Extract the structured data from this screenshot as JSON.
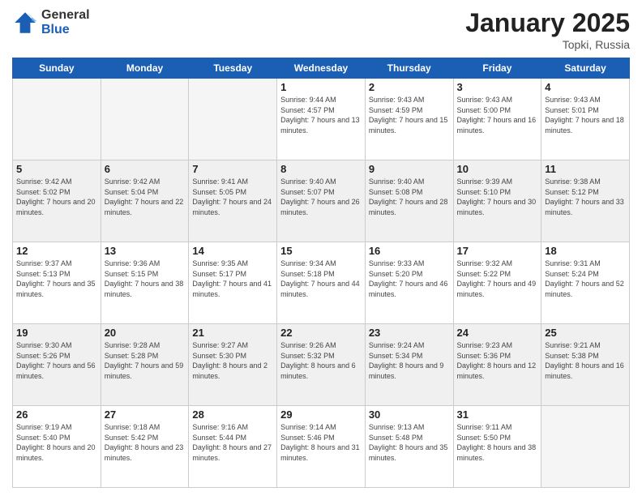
{
  "logo": {
    "general": "General",
    "blue": "Blue"
  },
  "title": {
    "month_year": "January 2025",
    "location": "Topki, Russia"
  },
  "headers": [
    "Sunday",
    "Monday",
    "Tuesday",
    "Wednesday",
    "Thursday",
    "Friday",
    "Saturday"
  ],
  "weeks": [
    [
      {
        "day": "",
        "sunrise": "",
        "sunset": "",
        "daylight": ""
      },
      {
        "day": "",
        "sunrise": "",
        "sunset": "",
        "daylight": ""
      },
      {
        "day": "",
        "sunrise": "",
        "sunset": "",
        "daylight": ""
      },
      {
        "day": "1",
        "sunrise": "Sunrise: 9:44 AM",
        "sunset": "Sunset: 4:57 PM",
        "daylight": "Daylight: 7 hours and 13 minutes."
      },
      {
        "day": "2",
        "sunrise": "Sunrise: 9:43 AM",
        "sunset": "Sunset: 4:59 PM",
        "daylight": "Daylight: 7 hours and 15 minutes."
      },
      {
        "day": "3",
        "sunrise": "Sunrise: 9:43 AM",
        "sunset": "Sunset: 5:00 PM",
        "daylight": "Daylight: 7 hours and 16 minutes."
      },
      {
        "day": "4",
        "sunrise": "Sunrise: 9:43 AM",
        "sunset": "Sunset: 5:01 PM",
        "daylight": "Daylight: 7 hours and 18 minutes."
      }
    ],
    [
      {
        "day": "5",
        "sunrise": "Sunrise: 9:42 AM",
        "sunset": "Sunset: 5:02 PM",
        "daylight": "Daylight: 7 hours and 20 minutes."
      },
      {
        "day": "6",
        "sunrise": "Sunrise: 9:42 AM",
        "sunset": "Sunset: 5:04 PM",
        "daylight": "Daylight: 7 hours and 22 minutes."
      },
      {
        "day": "7",
        "sunrise": "Sunrise: 9:41 AM",
        "sunset": "Sunset: 5:05 PM",
        "daylight": "Daylight: 7 hours and 24 minutes."
      },
      {
        "day": "8",
        "sunrise": "Sunrise: 9:40 AM",
        "sunset": "Sunset: 5:07 PM",
        "daylight": "Daylight: 7 hours and 26 minutes."
      },
      {
        "day": "9",
        "sunrise": "Sunrise: 9:40 AM",
        "sunset": "Sunset: 5:08 PM",
        "daylight": "Daylight: 7 hours and 28 minutes."
      },
      {
        "day": "10",
        "sunrise": "Sunrise: 9:39 AM",
        "sunset": "Sunset: 5:10 PM",
        "daylight": "Daylight: 7 hours and 30 minutes."
      },
      {
        "day": "11",
        "sunrise": "Sunrise: 9:38 AM",
        "sunset": "Sunset: 5:12 PM",
        "daylight": "Daylight: 7 hours and 33 minutes."
      }
    ],
    [
      {
        "day": "12",
        "sunrise": "Sunrise: 9:37 AM",
        "sunset": "Sunset: 5:13 PM",
        "daylight": "Daylight: 7 hours and 35 minutes."
      },
      {
        "day": "13",
        "sunrise": "Sunrise: 9:36 AM",
        "sunset": "Sunset: 5:15 PM",
        "daylight": "Daylight: 7 hours and 38 minutes."
      },
      {
        "day": "14",
        "sunrise": "Sunrise: 9:35 AM",
        "sunset": "Sunset: 5:17 PM",
        "daylight": "Daylight: 7 hours and 41 minutes."
      },
      {
        "day": "15",
        "sunrise": "Sunrise: 9:34 AM",
        "sunset": "Sunset: 5:18 PM",
        "daylight": "Daylight: 7 hours and 44 minutes."
      },
      {
        "day": "16",
        "sunrise": "Sunrise: 9:33 AM",
        "sunset": "Sunset: 5:20 PM",
        "daylight": "Daylight: 7 hours and 46 minutes."
      },
      {
        "day": "17",
        "sunrise": "Sunrise: 9:32 AM",
        "sunset": "Sunset: 5:22 PM",
        "daylight": "Daylight: 7 hours and 49 minutes."
      },
      {
        "day": "18",
        "sunrise": "Sunrise: 9:31 AM",
        "sunset": "Sunset: 5:24 PM",
        "daylight": "Daylight: 7 hours and 52 minutes."
      }
    ],
    [
      {
        "day": "19",
        "sunrise": "Sunrise: 9:30 AM",
        "sunset": "Sunset: 5:26 PM",
        "daylight": "Daylight: 7 hours and 56 minutes."
      },
      {
        "day": "20",
        "sunrise": "Sunrise: 9:28 AM",
        "sunset": "Sunset: 5:28 PM",
        "daylight": "Daylight: 7 hours and 59 minutes."
      },
      {
        "day": "21",
        "sunrise": "Sunrise: 9:27 AM",
        "sunset": "Sunset: 5:30 PM",
        "daylight": "Daylight: 8 hours and 2 minutes."
      },
      {
        "day": "22",
        "sunrise": "Sunrise: 9:26 AM",
        "sunset": "Sunset: 5:32 PM",
        "daylight": "Daylight: 8 hours and 6 minutes."
      },
      {
        "day": "23",
        "sunrise": "Sunrise: 9:24 AM",
        "sunset": "Sunset: 5:34 PM",
        "daylight": "Daylight: 8 hours and 9 minutes."
      },
      {
        "day": "24",
        "sunrise": "Sunrise: 9:23 AM",
        "sunset": "Sunset: 5:36 PM",
        "daylight": "Daylight: 8 hours and 12 minutes."
      },
      {
        "day": "25",
        "sunrise": "Sunrise: 9:21 AM",
        "sunset": "Sunset: 5:38 PM",
        "daylight": "Daylight: 8 hours and 16 minutes."
      }
    ],
    [
      {
        "day": "26",
        "sunrise": "Sunrise: 9:19 AM",
        "sunset": "Sunset: 5:40 PM",
        "daylight": "Daylight: 8 hours and 20 minutes."
      },
      {
        "day": "27",
        "sunrise": "Sunrise: 9:18 AM",
        "sunset": "Sunset: 5:42 PM",
        "daylight": "Daylight: 8 hours and 23 minutes."
      },
      {
        "day": "28",
        "sunrise": "Sunrise: 9:16 AM",
        "sunset": "Sunset: 5:44 PM",
        "daylight": "Daylight: 8 hours and 27 minutes."
      },
      {
        "day": "29",
        "sunrise": "Sunrise: 9:14 AM",
        "sunset": "Sunset: 5:46 PM",
        "daylight": "Daylight: 8 hours and 31 minutes."
      },
      {
        "day": "30",
        "sunrise": "Sunrise: 9:13 AM",
        "sunset": "Sunset: 5:48 PM",
        "daylight": "Daylight: 8 hours and 35 minutes."
      },
      {
        "day": "31",
        "sunrise": "Sunrise: 9:11 AM",
        "sunset": "Sunset: 5:50 PM",
        "daylight": "Daylight: 8 hours and 38 minutes."
      },
      {
        "day": "",
        "sunrise": "",
        "sunset": "",
        "daylight": ""
      }
    ]
  ]
}
